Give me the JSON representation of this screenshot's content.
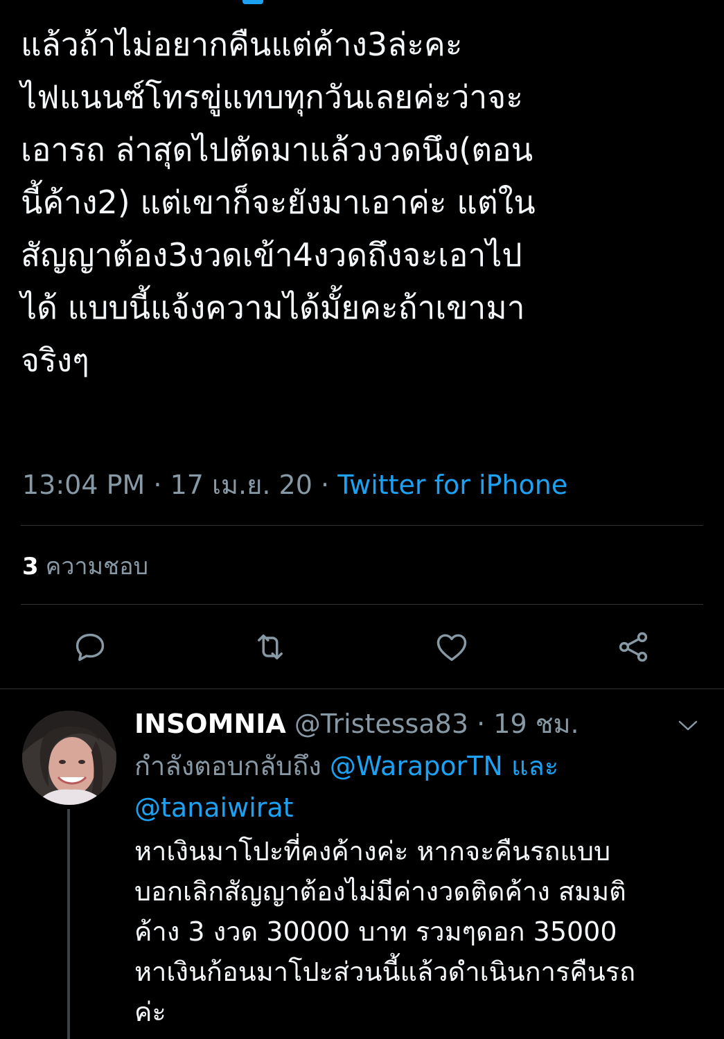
{
  "theme": {
    "background": "#000000",
    "text": "#f5f8fa",
    "muted": "#8899a6",
    "accent": "#1da1f2",
    "divider": "#2f3336"
  },
  "main_tweet": {
    "lines": [
      "แล้วถ้าไม่อยากคืนแต่ค้าง3ล่ะคะ",
      "ไฟแนนซ์โทรขู่แทบทุกวันเลยค่ะว่าจะ",
      "เอารถ ล่าสุดไปตัดมาแล้วงวดนึง(ตอน",
      "นี้ค้าง2) แต่เขาก็จะยังมาเอาค่ะ แต่ใน",
      "สัญญาต้อง3งวดเข้า4งวดถึงจะเอาไป",
      "ได้ แบบนี้แจ้งความได้มั้ยคะถ้าเขามา",
      "จริงๆ"
    ],
    "time": "13:04 PM",
    "separator": "·",
    "date": "17 เม.ย. 20",
    "source": "Twitter for iPhone",
    "likes_count": "3",
    "likes_label": "ความชอบ"
  },
  "actions": [
    {
      "icon": "reply-icon"
    },
    {
      "icon": "retweet-icon"
    },
    {
      "icon": "like-icon"
    },
    {
      "icon": "share-icon"
    }
  ],
  "reply": {
    "name": "INSOMNIA",
    "handle": "@Tristessa83",
    "separator": "·",
    "time": "19 ชม.",
    "replying_prefix": "กำลังตอบกลับถึง",
    "mention_1": "@WaraporTN",
    "connector": "และ",
    "mention_2": "@tanaiwirat",
    "lines": [
      "หาเงินมาโปะที่คงค้างค่ะ หากจะคืนรถแบบ",
      "บอกเลิกสัญญาต้องไม่มีค่างวดติดค้าง สมมติ",
      "ค้าง 3 งวด 30000 บาท รวมๆดอก 35000",
      "หาเงินก้อนมาโปะส่วนนี้แล้วดำเนินการคืนรถ",
      "ค่ะ"
    ]
  }
}
